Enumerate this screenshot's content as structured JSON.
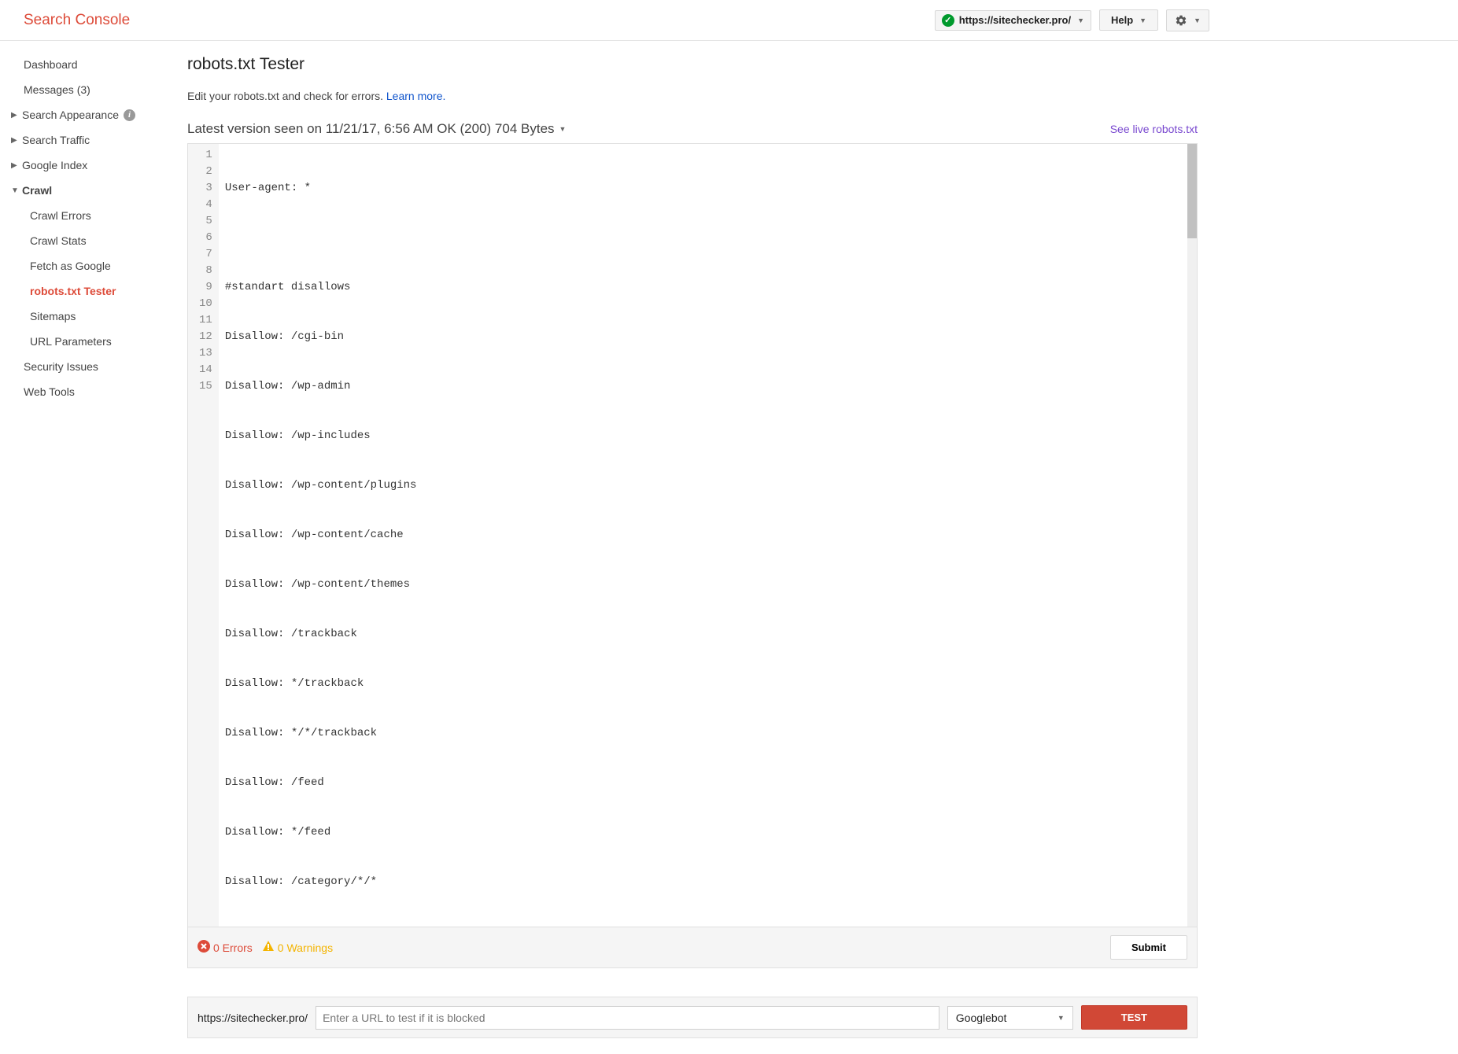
{
  "header": {
    "title": "Search Console",
    "site_url": "https://sitechecker.pro/",
    "help_label": "Help"
  },
  "sidebar": {
    "dashboard": "Dashboard",
    "messages": "Messages (3)",
    "search_appearance": "Search Appearance",
    "search_traffic": "Search Traffic",
    "google_index": "Google Index",
    "crawl": "Crawl",
    "crawl_items": {
      "errors": "Crawl Errors",
      "stats": "Crawl Stats",
      "fetch": "Fetch as Google",
      "robots": "robots.txt Tester",
      "sitemaps": "Sitemaps",
      "url_params": "URL Parameters"
    },
    "security": "Security Issues",
    "web_tools": "Web Tools"
  },
  "main": {
    "title": "robots.txt Tester",
    "subtitle": "Edit your robots.txt and check for errors.",
    "learn_more": "Learn more.",
    "version": "Latest version seen on 11/21/17, 6:56 AM OK (200) 704 Bytes",
    "live_link": "See live robots.txt",
    "code": {
      "l1": "User-agent: *",
      "l2": "",
      "l3": "#standart disallows",
      "l4": "Disallow: /cgi-bin",
      "l5": "Disallow: /wp-admin",
      "l6": "Disallow: /wp-includes",
      "l7": "Disallow: /wp-content/plugins",
      "l8": "Disallow: /wp-content/cache",
      "l9": "Disallow: /wp-content/themes",
      "l10": "Disallow: /trackback",
      "l11": "Disallow: */trackback",
      "l12": "Disallow: */*/trackback",
      "l13": "Disallow: /feed",
      "l14": "Disallow: */feed",
      "l15": "Disallow: /category/*/*"
    },
    "gutter": {
      "n1": "1",
      "n2": "2",
      "n3": "3",
      "n4": "4",
      "n5": "5",
      "n6": "6",
      "n7": "7",
      "n8": "8",
      "n9": "9",
      "n10": "10",
      "n11": "11",
      "n12": "12",
      "n13": "13",
      "n14": "14",
      "n15": "15"
    },
    "errors_count": "0 Errors",
    "warnings_count": "0 Warnings",
    "submit_label": "Submit",
    "url_prefix": "https://sitechecker.pro/",
    "url_placeholder": "Enter a URL to test if it is blocked",
    "bot_label": "Googlebot",
    "test_label": "TEST"
  }
}
